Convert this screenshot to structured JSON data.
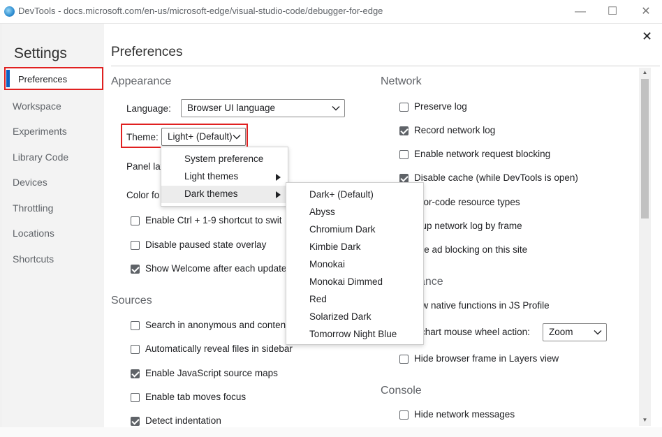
{
  "window": {
    "title": "DevTools - docs.microsoft.com/en-us/microsoft-edge/visual-studio-code/debugger-for-edge",
    "minimize_glyph": "—",
    "maximize_glyph": "☐",
    "close_glyph": "✕"
  },
  "sidebar": {
    "title": "Settings",
    "items": [
      "Preferences",
      "Workspace",
      "Experiments",
      "Library Code",
      "Devices",
      "Throttling",
      "Locations",
      "Shortcuts"
    ],
    "selected": "Preferences"
  },
  "page": {
    "title": "Preferences",
    "close_glyph": "✕"
  },
  "appearance": {
    "title": "Appearance",
    "language_label": "Language:",
    "language_value": "Browser UI language",
    "theme_label": "Theme:",
    "theme_value": "Light+ (Default)",
    "panel_layout_label": "Panel lay",
    "color_format_label": "Color fo",
    "checkboxes": [
      {
        "label": "Enable Ctrl + 1-9 shortcut to swit",
        "checked": false
      },
      {
        "label": "Disable paused state overlay",
        "checked": false
      },
      {
        "label": "Show Welcome after each update",
        "checked": true
      }
    ]
  },
  "sources": {
    "title": "Sources",
    "checkboxes": [
      {
        "label": "Search in anonymous and conten",
        "checked": false
      },
      {
        "label": "Automatically reveal files in sidebar",
        "checked": false
      },
      {
        "label": "Enable JavaScript source maps",
        "checked": true
      },
      {
        "label": "Enable tab moves focus",
        "checked": false
      },
      {
        "label": "Detect indentation",
        "checked": true
      }
    ]
  },
  "network": {
    "title": "Network",
    "checkboxes": [
      {
        "label": "Preserve log",
        "checked": false
      },
      {
        "label": "Record network log",
        "checked": true
      },
      {
        "label": "Enable network request blocking",
        "checked": false
      },
      {
        "label": "Disable cache (while DevTools is open)",
        "checked": true
      },
      {
        "label": "olor-code resource types",
        "checked": false
      },
      {
        "label": "oup network log by frame",
        "checked": false
      },
      {
        "label": "rce ad blocking on this site",
        "checked": false
      }
    ]
  },
  "performance": {
    "title": "ance",
    "show_native_label": "ow native functions in JS Profile",
    "wheel_label": "chart mouse wheel action:",
    "wheel_value": "Zoom",
    "hide_frame_label": "Hide browser frame in Layers view",
    "hide_frame_checked": false
  },
  "console": {
    "title": "Console",
    "hide_network_label": "Hide network messages",
    "hide_network_checked": false
  },
  "theme_menu": {
    "items": [
      {
        "label": "System preference",
        "submenu": false
      },
      {
        "label": "Light themes",
        "submenu": true
      },
      {
        "label": "Dark themes",
        "submenu": true
      }
    ],
    "highlighted": "Dark themes"
  },
  "dark_themes_menu": {
    "items": [
      "Dark+ (Default)",
      "Abyss",
      "Chromium Dark",
      "Kimbie Dark",
      "Monokai",
      "Monokai Dimmed",
      "Red",
      "Solarized Dark",
      "Tomorrow Night Blue"
    ]
  },
  "colors": {
    "highlight_border": "#e02020",
    "accent": "#0a60c2"
  }
}
